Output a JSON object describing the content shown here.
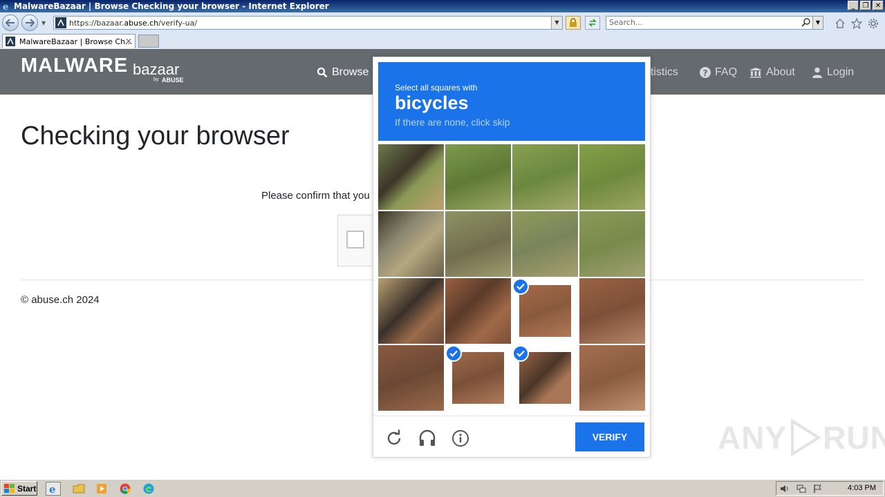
{
  "window": {
    "title": "MalwareBazaar | Browse Checking your browser - Internet Explorer"
  },
  "browser": {
    "url_prefix": "https://bazaar.",
    "url_host": "abuse.ch",
    "url_path": "/verify-ua/",
    "search_placeholder": "Search...",
    "tab_title": "MalwareBazaar | Browse Ch...",
    "tab_close": "✕"
  },
  "site": {
    "logo_main": "MALWARE",
    "logo_sub": "bazaar",
    "logo_by": "by",
    "logo_org": "ABUSE",
    "nav": [
      {
        "label": "Browse",
        "icon": "search-icon"
      },
      {
        "label": "Statistics",
        "icon": "chart-icon"
      },
      {
        "label": "FAQ",
        "icon": "question-icon"
      },
      {
        "label": "About",
        "icon": "building-icon"
      },
      {
        "label": "Login",
        "icon": "user-icon"
      }
    ],
    "nav_partial": "atistics"
  },
  "page": {
    "title": "Checking your browser",
    "confirm_text": "Please confirm that you",
    "footer": "© abuse.ch 2024"
  },
  "challenge": {
    "prompt_line1": "Select all squares with",
    "prompt_word": "bicycles",
    "prompt_hint": "If there are none, click skip",
    "selected_cells": [
      10,
      13,
      14
    ],
    "verify_label": "VERIFY"
  },
  "watermark": {
    "text_left": "ANY",
    "text_right": "RUN"
  },
  "taskbar": {
    "start_label": "Start",
    "clock": "4:03 PM"
  },
  "colors": {
    "challenge_blue": "#1a73e8",
    "header_gray": "#656a6f"
  }
}
